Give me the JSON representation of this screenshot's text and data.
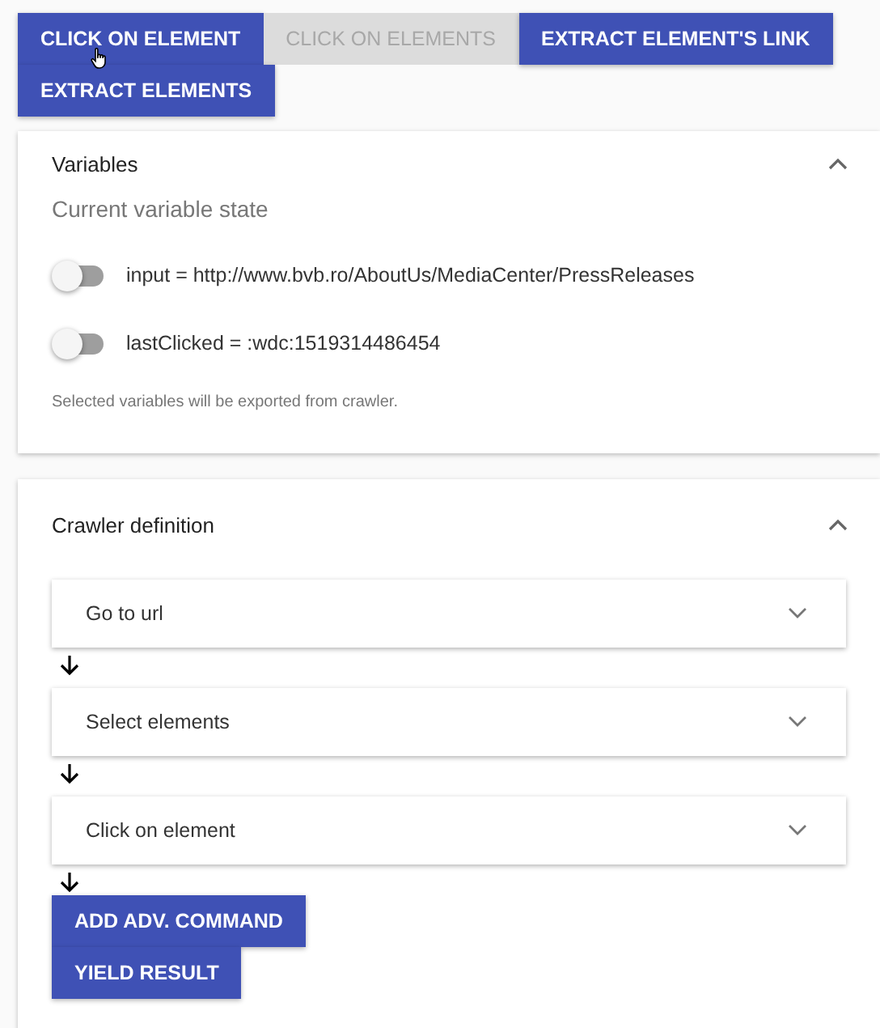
{
  "actions": [
    {
      "label": "CLICK ON ELEMENT",
      "disabled": false
    },
    {
      "label": "CLICK ON ELEMENTS",
      "disabled": true
    },
    {
      "label": "EXTRACT ELEMENT'S LINK",
      "disabled": false
    },
    {
      "label": "EXTRACT ELEMENTS",
      "disabled": false
    }
  ],
  "variables_panel": {
    "title": "Variables",
    "expanded": true,
    "subtitle": "Current variable state",
    "variables": [
      {
        "label": "input = http://www.bvb.ro/AboutUs/MediaCenter/PressReleases",
        "checked": false
      },
      {
        "label": "lastClicked = :wdc:1519314486454",
        "checked": false
      }
    ],
    "hint": "Selected variables will be exported from crawler."
  },
  "crawler_panel": {
    "title": "Crawler definition",
    "expanded": true,
    "steps": [
      {
        "label": "Go to url",
        "expanded": false
      },
      {
        "label": "Select elements",
        "expanded": false
      },
      {
        "label": "Click on element",
        "expanded": false
      }
    ],
    "buttons": [
      "ADD ADV. COMMAND",
      "YIELD RESULT"
    ]
  }
}
